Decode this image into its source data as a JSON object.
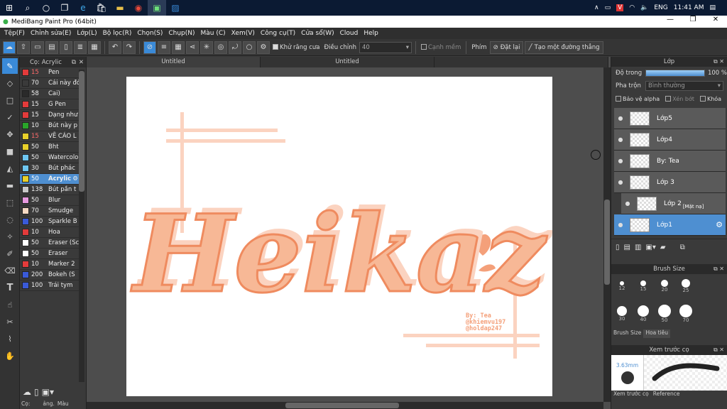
{
  "taskbar": {
    "lang": "ENG",
    "time": "11:41 AM"
  },
  "app": {
    "title": "MediBang Paint Pro (64bit)"
  },
  "menu": [
    "Tệp(F)",
    "Chỉnh sửa(E)",
    "Lớp(L)",
    "Bộ lọc(R)",
    "Chọn(S)",
    "Chụp(N)",
    "Màu (C)",
    "Xem(V)",
    "Công cụ(T)",
    "Cửa sổ(W)",
    "Cloud",
    "Help"
  ],
  "toolbar": {
    "antialias_label": "Khử răng cưa",
    "adjust_label": "Điều chỉnh",
    "adjust_value": "40",
    "snap_label": "Cạnh mềm",
    "key_label": "Phím",
    "reset_label": "Đặt lại",
    "line_label": "Tạo một đường thẳng"
  },
  "brush_panel": {
    "title": "Cọ: Acrylic",
    "brushes": [
      {
        "size": "15",
        "name": "Pen",
        "color": "#e33b3b",
        "size_color": "#ff6a6a"
      },
      {
        "size": "70",
        "name": "Cái này đó",
        "color": "#3a3a3a",
        "size_color": "#eeeeee"
      },
      {
        "size": "58",
        "name": "Cai)",
        "color": "#2a2a2a",
        "size_color": "#eeeeee"
      },
      {
        "size": "15",
        "name": "G Pen",
        "color": "#e33b3b",
        "size_color": "#eeeeee"
      },
      {
        "size": "15",
        "name": "Dạng như",
        "color": "#e33b3b",
        "size_color": "#eeeeee"
      },
      {
        "size": "10",
        "name": "Bút này p",
        "color": "#2aa52a",
        "size_color": "#eeeeee"
      },
      {
        "size": "15",
        "name": "VẼ CÁO L",
        "color": "#e8d02a",
        "size_color": "#ff6a6a"
      },
      {
        "size": "50",
        "name": "Bht",
        "color": "#e8d02a",
        "size_color": "#eeeeee"
      },
      {
        "size": "50",
        "name": "Watercolo",
        "color": "#6ec6f0",
        "size_color": "#eeeeee"
      },
      {
        "size": "30",
        "name": "Bút phác",
        "color": "#6ec6f0",
        "size_color": "#eeeeee"
      },
      {
        "size": "50",
        "name": "Acrylic",
        "color": "#e8d02a",
        "size_color": "#ffffff",
        "selected": true
      },
      {
        "size": "138",
        "name": "Bút pần t",
        "color": "#c8c8c8",
        "size_color": "#eeeeee"
      },
      {
        "size": "50",
        "name": "Blur",
        "color": "#e89ae0",
        "size_color": "#eeeeee"
      },
      {
        "size": "70",
        "name": "Smudge",
        "color": "#f5d9c4",
        "size_color": "#eeeeee"
      },
      {
        "size": "100",
        "name": "Sparkle B",
        "color": "#3a5ad8",
        "size_color": "#eeeeee"
      },
      {
        "size": "10",
        "name": "Hoa",
        "color": "#e33b3b",
        "size_color": "#eeeeee"
      },
      {
        "size": "50",
        "name": "Eraser (Sc",
        "color": "#ffffff",
        "size_color": "#eeeeee"
      },
      {
        "size": "50",
        "name": "Eraser",
        "color": "#ffffff",
        "size_color": "#eeeeee"
      },
      {
        "size": "10",
        "name": "Marker 2",
        "color": "#e33b3b",
        "size_color": "#eeeeee"
      },
      {
        "size": "200",
        "name": "Bokeh (S",
        "color": "#3a5ad8",
        "size_color": "#eeeeee"
      },
      {
        "size": "100",
        "name": "Trái tym",
        "color": "#3a5ad8",
        "size_color": "#eeeeee"
      }
    ],
    "tabs": [
      "Cọ:",
      "ảng.",
      "Màu"
    ]
  },
  "doc_tabs": [
    "Untitled",
    "Untitled"
  ],
  "artwork": {
    "main_text": "Heikaz",
    "credit_lines": [
      "By: Tea",
      "@khiemvu197",
      "@holdap247"
    ]
  },
  "layer_panel": {
    "title": "Lớp",
    "opacity_label": "Độ trong",
    "opacity_value": "100 %",
    "opacity_fraction": 1.0,
    "blend_label": "Pha trộn",
    "blend_value": "Bình thường",
    "protect_alpha": "Bảo vệ alpha",
    "clip": "Xén bớt",
    "lock": "Khóa",
    "layers": [
      {
        "name": "Lớp5"
      },
      {
        "name": "Lớp4"
      },
      {
        "name": "By: Tea"
      },
      {
        "name": "Lớp 3"
      },
      {
        "name": "Lớp 2",
        "tag": "[Mặt nạ]",
        "sub": true
      },
      {
        "name": "Lớp1",
        "selected": true
      }
    ]
  },
  "brush_size_panel": {
    "title": "Brush Size",
    "sizes": [
      "12",
      "15",
      "20",
      "25",
      "30",
      "40",
      "50",
      "70"
    ],
    "tabs": [
      "Brush Size",
      "Hoa tiêu"
    ]
  },
  "preview_panel": {
    "title": "Xem trước cọ",
    "size_value": "3.63mm",
    "tabs": [
      "Xem trước cọ",
      "Reference"
    ]
  },
  "colors": {
    "accent": "#4e8fd1",
    "peach": "#f4a07a",
    "peach_light": "#fbd3c0"
  }
}
